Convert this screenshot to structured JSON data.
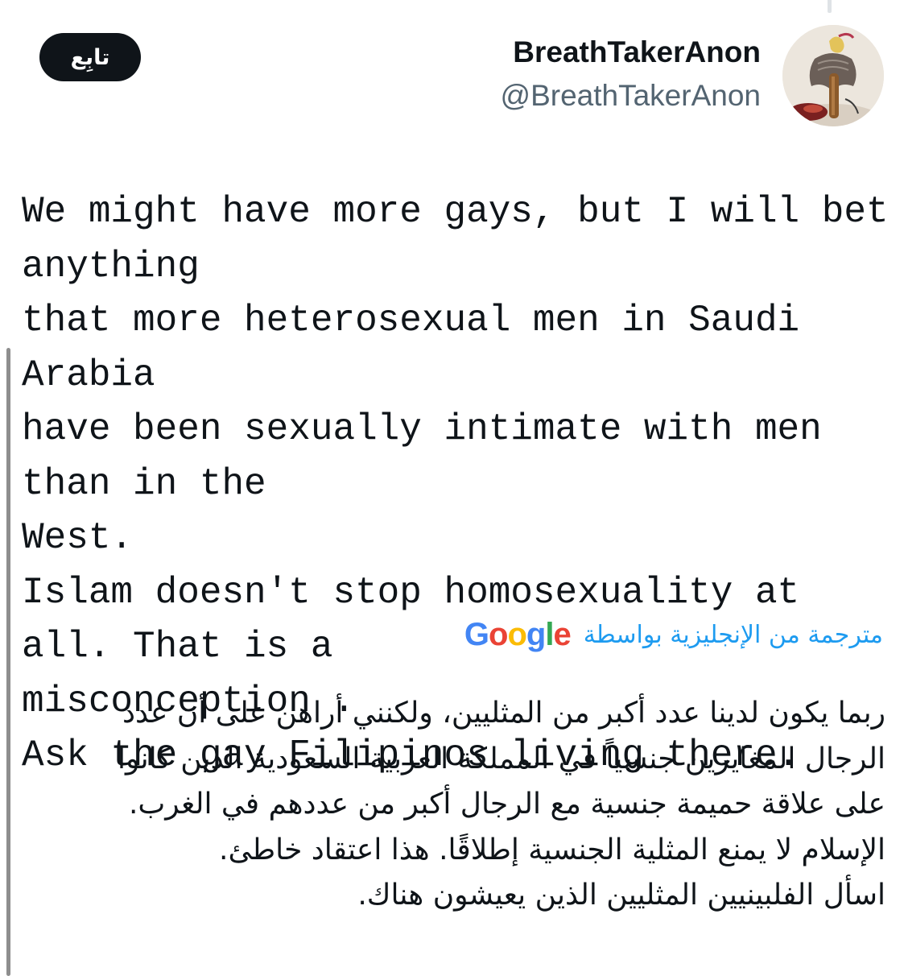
{
  "header": {
    "follow_label": "تابِع",
    "display_name": "BreathTakerAnon",
    "handle": "@BreathTakerAnon"
  },
  "icons": {
    "avatar": "profile-avatar-figure-image"
  },
  "tweet": {
    "text": "We might have more gays, but I will bet anything\nthat more heterosexual men in Saudi Arabia\nhave been sexually intimate with men than in the\nWest.\nIslam doesn't stop homosexuality at all. That is a\nmisconception .\nAsk the gay Filipinos living there."
  },
  "translation": {
    "label": "مترجمة من الإنجليزية بواسطة",
    "provider": [
      "G",
      "o",
      "o",
      "g",
      "l",
      "e"
    ],
    "provider_colors": [
      "#4285F4",
      "#EA4335",
      "#FBBC05",
      "#4285F4",
      "#34A853",
      "#EA4335"
    ],
    "text": "ربما يكون لدينا عدد أكبر من المثليين، ولكنني أراهن على أن عدد\nالرجال المغايرين جنسياً في المملكة العربية السعودية الذين كانوا\nعلى علاقة حميمة جنسية مع الرجال أكبر من عددهم في الغرب.\nالإسلام لا يمنع المثلية الجنسية إطلاقًا. هذا اعتقاد خاطئ.\nاسأل الفلبينيين المثليين الذين يعيشون هناك."
  },
  "colors": {
    "text_primary": "#0f1419",
    "text_secondary": "#536471",
    "link_blue": "#1d9bf0",
    "button_bg": "#0f1419",
    "quote_bar": "#8e8e8e"
  }
}
